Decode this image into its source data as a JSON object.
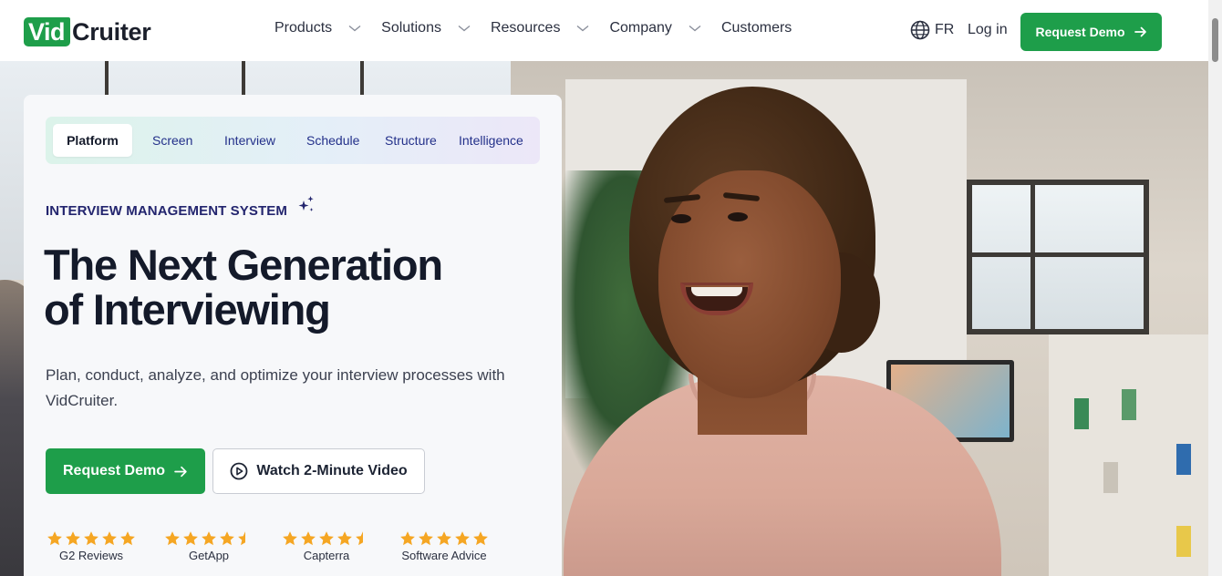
{
  "header": {
    "logo": {
      "part1": "Vid",
      "part2": "Cruiter"
    },
    "nav": [
      {
        "label": "Products",
        "has_dropdown": true
      },
      {
        "label": "Solutions",
        "has_dropdown": true
      },
      {
        "label": "Resources",
        "has_dropdown": true
      },
      {
        "label": "Company",
        "has_dropdown": true
      },
      {
        "label": "Customers",
        "has_dropdown": false
      }
    ],
    "language": "FR",
    "login": "Log in",
    "cta": "Request Demo"
  },
  "hero": {
    "tabs": [
      {
        "label": "Platform",
        "active": true
      },
      {
        "label": "Screen",
        "active": false
      },
      {
        "label": "Interview",
        "active": false
      },
      {
        "label": "Schedule",
        "active": false
      },
      {
        "label": "Structure",
        "active": false
      },
      {
        "label": "Intelligence",
        "active": false
      }
    ],
    "eyebrow": "INTERVIEW MANAGEMENT SYSTEM",
    "headline_line1": "The Next Generation",
    "headline_line2": "of Interviewing",
    "subtext": "Plan, conduct, analyze, and optimize your interview processes with VidCruiter.",
    "primary_cta": "Request Demo",
    "secondary_cta": "Watch 2-Minute Video",
    "ratings": [
      {
        "label": "G2 Reviews",
        "stars": 5
      },
      {
        "label": "GetApp",
        "stars": 4.5
      },
      {
        "label": "Capterra",
        "stars": 4.5
      },
      {
        "label": "Software Advice",
        "stars": 5
      }
    ]
  },
  "colors": {
    "brand_green": "#1e9e4a",
    "navy": "#23256e",
    "star": "#f5a623",
    "text_dark": "#141a2a"
  },
  "icons": {
    "language": "globe-icon",
    "cta_arrow": "arrow-right-icon",
    "dropdown": "chevron-down-icon",
    "video": "play-circle-icon",
    "eyebrow_decoration": "sparkle-icon",
    "rating": "star-icon"
  }
}
